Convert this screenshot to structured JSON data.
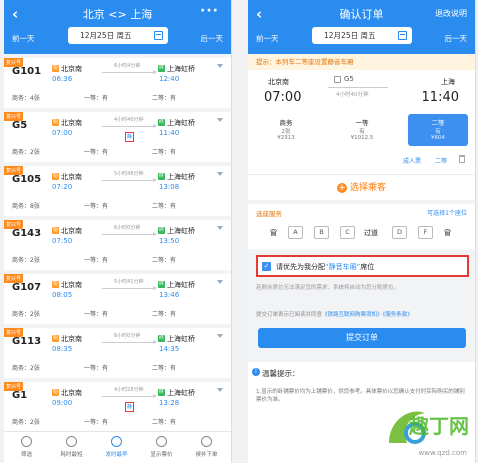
{
  "left": {
    "title": "北京 <> 上海",
    "more": "···",
    "prev_day": "前一天",
    "next_day": "后一天",
    "date": "12月25日 周五",
    "tag": "复兴号",
    "trains": [
      {
        "no": "G101",
        "dep": "北京南",
        "arr": "上海虹桥",
        "dep_t": "06:36",
        "arr_t": "12:40",
        "dur": "6小时4分钟",
        "seats": [
          "商务：4张",
          "一等：有",
          "二等：有"
        ],
        "quiet": "",
        "tag": "复兴号"
      },
      {
        "no": "G5",
        "dep": "北京南",
        "arr": "上海虹桥",
        "dep_t": "07:00",
        "arr_t": "11:40",
        "dur": "4小时40分钟",
        "seats": [
          "商务：2张",
          "一等：有",
          "二等：有"
        ],
        "quiet": "静",
        "tag": "复兴号"
      },
      {
        "no": "G105",
        "dep": "北京南",
        "arr": "上海虹桥",
        "dep_t": "07:20",
        "arr_t": "13:08",
        "dur": "5小时48分钟",
        "seats": [
          "商务：8张",
          "一等：有",
          "二等：有"
        ],
        "quiet": "",
        "tag": "复兴号"
      },
      {
        "no": "G143",
        "dep": "北京南",
        "arr": "上海虹桥",
        "dep_t": "07:50",
        "arr_t": "13:50",
        "dur": "6小时0分钟",
        "seats": [
          "商务：2张",
          "一等：有",
          "二等：有"
        ],
        "quiet": "",
        "tag": "复兴号"
      },
      {
        "no": "G107",
        "dep": "北京南",
        "arr": "上海虹桥",
        "dep_t": "08:05",
        "arr_t": "13:46",
        "dur": "5小时41分钟",
        "seats": [
          "商务：2张",
          "一等：有",
          "二等：有"
        ],
        "quiet": "",
        "tag": "复兴号"
      },
      {
        "no": "G113",
        "dep": "北京南",
        "arr": "上海虹桥",
        "dep_t": "08:35",
        "arr_t": "14:35",
        "dur": "6小时0分钟",
        "seats": [
          "商务：2张",
          "一等：有",
          "二等：有"
        ],
        "quiet": "",
        "tag": "复兴号"
      },
      {
        "no": "G1",
        "dep": "北京南",
        "arr": "上海虹桥",
        "dep_t": "09:00",
        "arr_t": "13:28",
        "dur": "4小时28分钟",
        "seats": [
          "商务：2张",
          "一等：有",
          "二等：有"
        ],
        "quiet": "静",
        "tag": "复兴号"
      }
    ],
    "bottom": [
      "筛选",
      "耗时最短",
      "发时最早",
      "显示票价",
      "候补下单"
    ]
  },
  "right": {
    "title": "确认订单",
    "nav_right": "退改说明",
    "prev_day": "前一天",
    "next_day": "后一天",
    "date": "12月25日 周五",
    "notice": "提示：本列车二等座设置静音车厢",
    "from": "北京南",
    "to": "上海",
    "train_no": "G5",
    "dep_time": "07:00",
    "arr_time": "11:40",
    "duration": "4小时40分钟",
    "seats": [
      {
        "name": "商务",
        "count": "2张",
        "price": "¥2313"
      },
      {
        "name": "一等",
        "count": "有",
        "price": "¥1012.5"
      },
      {
        "name": "二等",
        "count": "有",
        "price": "¥604"
      }
    ],
    "passenger_type": "成人票",
    "passenger_class": "二等",
    "add_passenger": "选择乘客",
    "seat_label": "选座服务",
    "seat_count": "可选择1个座位",
    "window": "窗",
    "aisle": "过道",
    "seat_letters": [
      "A",
      "B",
      "C",
      "D",
      "F"
    ],
    "quiet_pre": "请优先为我分配",
    "quiet_hl": "“静音车厢”",
    "quiet_post": "席位",
    "hint": "若剩余席位无法满足您的需求，系统将自动为您分配席位。",
    "agree_pre": "提交订单表示已阅读并同意",
    "agree_link1": "《铁路互联网购票须知》",
    "agree_link2": "《服务条款》",
    "submit": "提交订单",
    "tips_title": "温馨提示：",
    "tips_text": "1.显示的卧铺票价均为上铺票价，供您参考。具体票价以您确认支付时实际购买的铺别票价为准。",
    "watermark": "趣丁网",
    "watermark_url": "www.qzd.com"
  }
}
